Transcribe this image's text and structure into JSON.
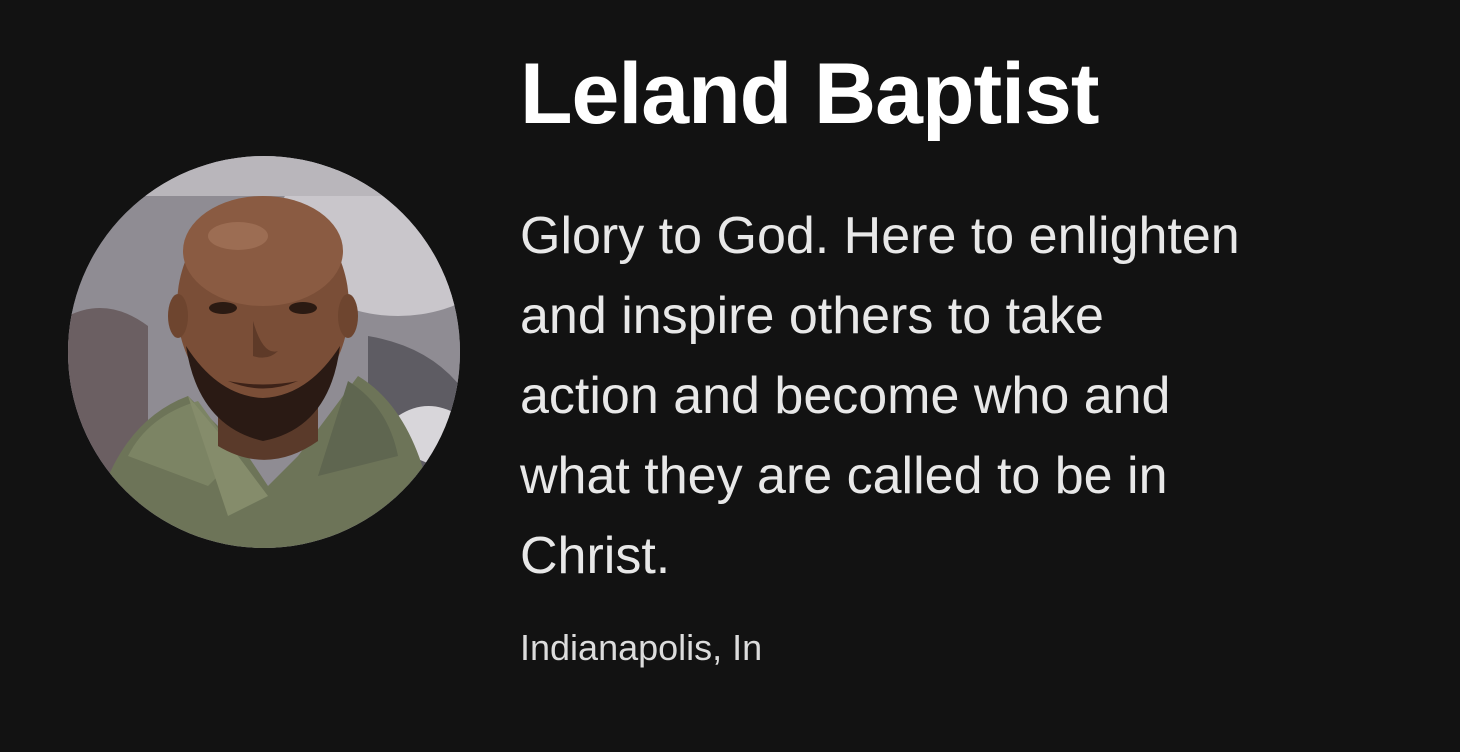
{
  "profile": {
    "name": "Leland Baptist",
    "bio_lines": [
      "Glory to God. Here to enlighten",
      "and inspire others to take",
      "action and become who and",
      "what they are called to be in",
      "Christ."
    ],
    "location": "Indianapolis, In",
    "avatar_icon": "profile-photo"
  },
  "colors": {
    "background": "#121212",
    "name_text": "#ffffff",
    "bio_text": "#e8e8e8",
    "location_text": "#dcdcdc"
  }
}
